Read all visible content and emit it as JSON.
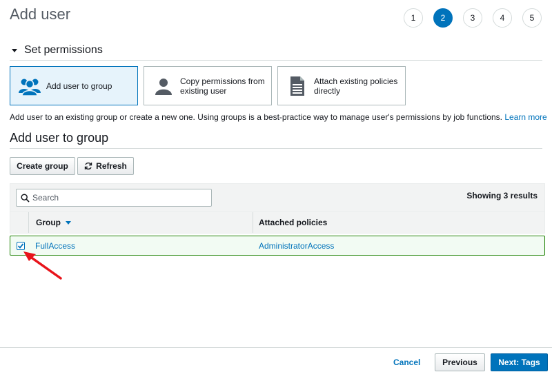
{
  "page": {
    "title": "Add user"
  },
  "steps": {
    "items": [
      "1",
      "2",
      "3",
      "4",
      "5"
    ],
    "active": "2"
  },
  "permissions": {
    "section_title": "Set permissions",
    "options": [
      {
        "label": "Add user to group",
        "icon": "users-group-icon",
        "selected": true
      },
      {
        "label": "Copy permissions from existing user",
        "icon": "user-icon",
        "selected": false
      },
      {
        "label": "Attach existing policies directly",
        "icon": "document-icon",
        "selected": false
      }
    ],
    "description": "Add user to an existing group or create a new one. Using groups is a best-practice way to manage user's permissions by job functions.",
    "learn_more": "Learn more"
  },
  "group_section": {
    "title": "Add user to group",
    "create_label": "Create group",
    "refresh_label": "Refresh"
  },
  "table": {
    "search_placeholder": "Search",
    "showing": "Showing 3 results",
    "columns": {
      "group": "Group",
      "policies": "Attached policies"
    },
    "rows": [
      {
        "group": "FullAccess",
        "policies": "AdministratorAccess",
        "checked": true
      }
    ]
  },
  "footer": {
    "cancel": "Cancel",
    "previous": "Previous",
    "next": "Next: Tags"
  },
  "colors": {
    "accent": "#0073bb",
    "selected_row_border": "#1d8102",
    "annotation_arrow": "#e8141b"
  }
}
